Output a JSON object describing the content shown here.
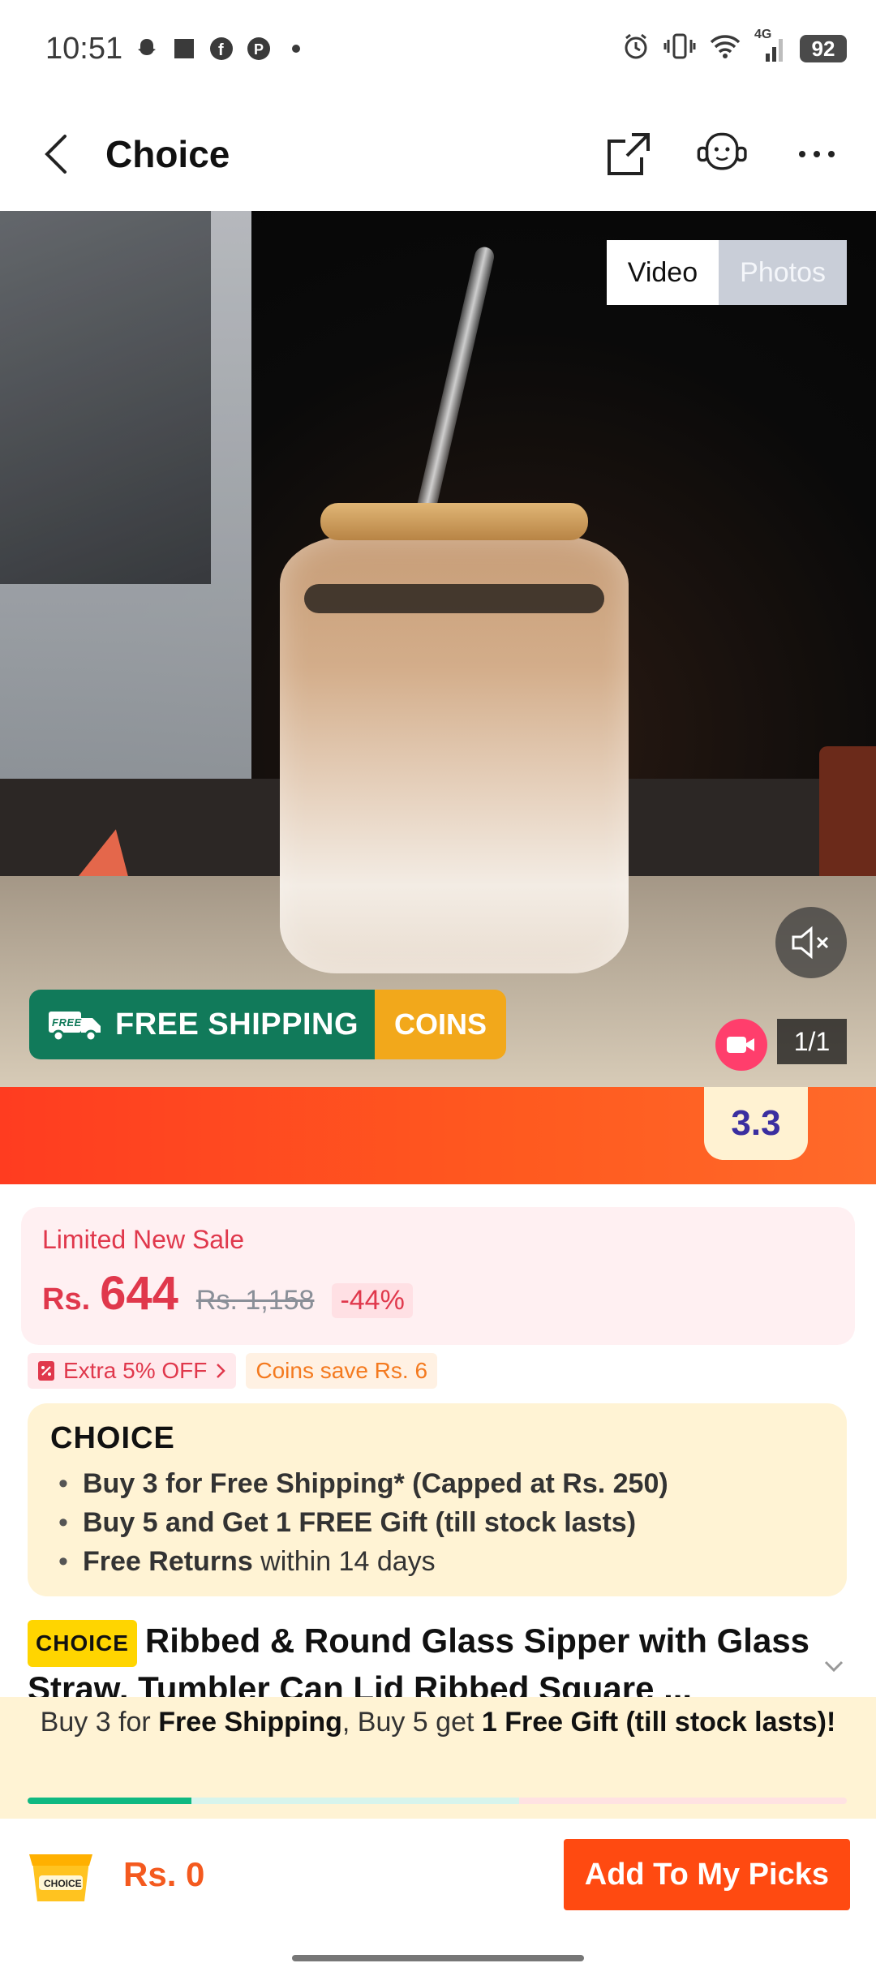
{
  "status": {
    "time": "10:51",
    "network": "4G",
    "battery": "92"
  },
  "header": {
    "title": "Choice"
  },
  "media": {
    "tabs": [
      "Video",
      "Photos"
    ],
    "active_tab": "Video",
    "counter": "1/1",
    "badge_free": "FREE",
    "badge_shipping": "FREE SHIPPING",
    "badge_coins": "COINS"
  },
  "promo": {
    "tag": "3.3"
  },
  "price": {
    "label": "Limited New Sale",
    "currency": "Rs.",
    "current": "644",
    "original": "Rs. 1,158",
    "discount": "-44%"
  },
  "chips": {
    "extra_off": "Extra 5% OFF",
    "coins_save": "Coins save Rs. 6"
  },
  "choice": {
    "logo": "CHOICE",
    "benefits": [
      {
        "bold": "Buy 3 for  Free Shipping* (Capped at Rs. 250)",
        "rest": ""
      },
      {
        "bold": "Buy 5 and Get 1 FREE Gift (till stock lasts)",
        "rest": ""
      },
      {
        "bold": "Free Returns",
        "rest": " within 14 days"
      }
    ]
  },
  "product": {
    "badge": "CHOICE",
    "title": "Ribbed & Round Glass Sipper with Glass Straw. Tumbler Can Lid Ribbed Square ..."
  },
  "shipping_strip": {
    "t1": "Buy 3 for ",
    "b1": "Free Shipping",
    "t2": ", Buy 5 get ",
    "b2": "1 Free Gift (till stock lasts)!",
    "progress": 0.2
  },
  "bottom": {
    "cart_label": "CHOICE",
    "total": "Rs. 0",
    "add_button": "Add To My Picks"
  },
  "colors": {
    "accent": "#ff4a11",
    "price_red": "#e0384c",
    "green": "#117a5a",
    "coins": "#f2a81b",
    "choice_bg": "#fff3d4"
  }
}
